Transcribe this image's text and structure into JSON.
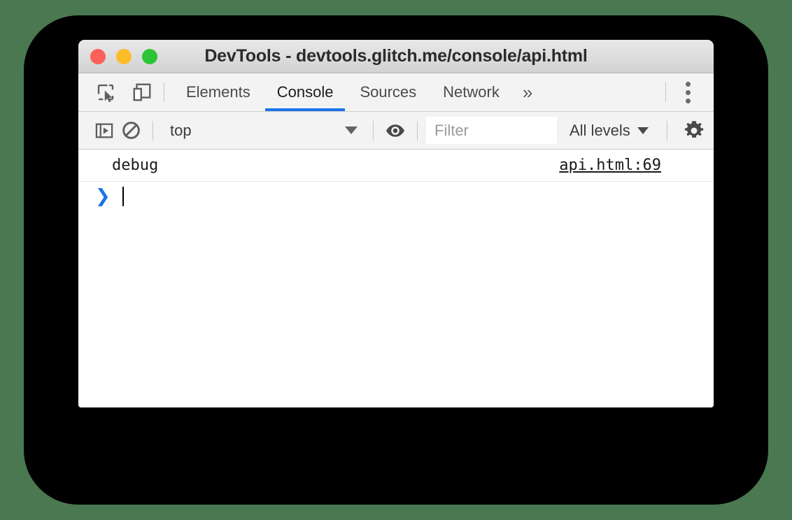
{
  "window": {
    "title": "DevTools - devtools.glitch.me/console/api.html",
    "traffic_lights": [
      {
        "name": "close",
        "color": "#fc6058"
      },
      {
        "name": "minimize",
        "color": "#fcbc2a"
      },
      {
        "name": "zoom",
        "color": "#2cc435"
      }
    ]
  },
  "colors": {
    "page_background": "#4a7850",
    "backdrop": "#000000",
    "accent": "#1a73e8",
    "toolbar": "#f3f3f3",
    "panel": "#ffffff"
  },
  "tabbar": {
    "icons": [
      {
        "name": "inspect-element-icon",
        "label": "Inspect element"
      },
      {
        "name": "device-toolbar-icon",
        "label": "Toggle device toolbar"
      }
    ],
    "tabs": [
      {
        "label": "Elements",
        "active": false
      },
      {
        "label": "Console",
        "active": true
      },
      {
        "label": "Sources",
        "active": false
      },
      {
        "label": "Network",
        "active": false
      }
    ],
    "more_tabs_label": "»",
    "menu_label": "Customize and control DevTools"
  },
  "filterbar": {
    "sidebar_toggle_label": "Show console sidebar",
    "clear_console_label": "Clear console",
    "context": {
      "value": "top",
      "caret": "▼"
    },
    "live_expression_label": "Create live expression",
    "filter": {
      "value": "",
      "placeholder": "Filter"
    },
    "levels": {
      "value": "All levels",
      "caret": "▼"
    },
    "settings_label": "Console settings"
  },
  "console": {
    "messages": [
      {
        "text": "debug",
        "source": "api.html:69"
      }
    ],
    "prompt": {
      "chevron": "❯",
      "input_value": ""
    }
  }
}
